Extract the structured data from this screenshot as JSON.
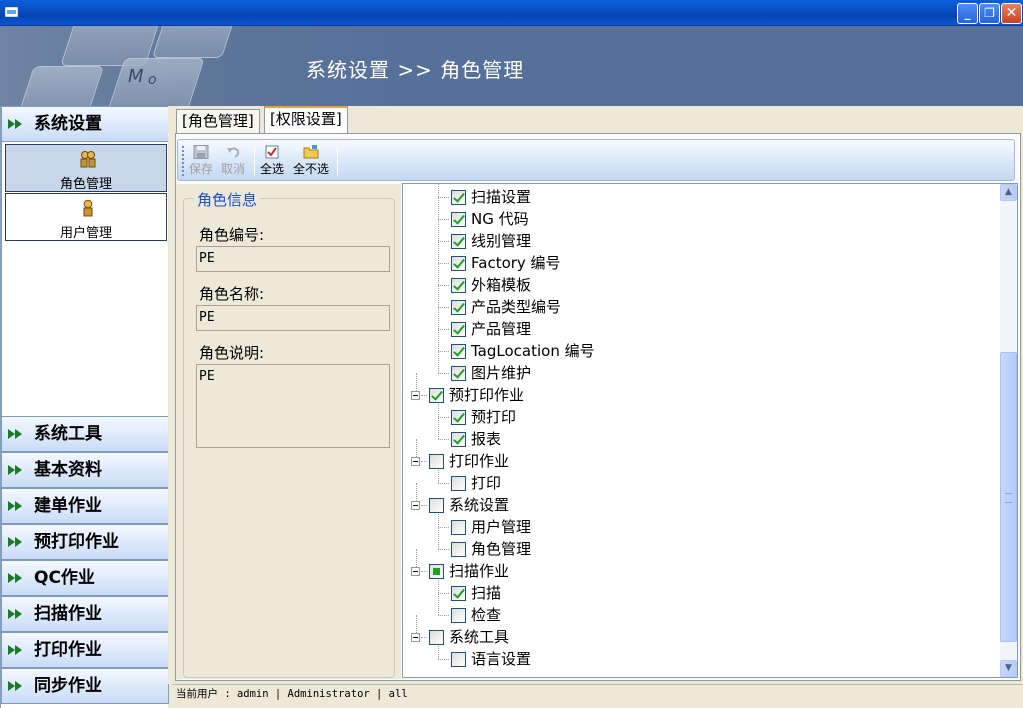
{
  "window": {
    "minimize_glyph": "_",
    "restore_glyph": "❐",
    "close_glyph": "✕"
  },
  "header": {
    "title": "系统设置 >> 角色管理",
    "keycap_letters": [
      "M",
      "o"
    ]
  },
  "sidebar": {
    "active_group": "系统设置",
    "active_subitems": [
      {
        "label": "角色管理",
        "icon": "users-icon",
        "selected": true
      },
      {
        "label": "用户管理",
        "icon": "user-icon",
        "selected": false
      }
    ],
    "groups": [
      "系统工具",
      "基本资料",
      "建单作业",
      "预打印作业",
      "QC作业",
      "扫描作业",
      "打印作业",
      "同步作业"
    ]
  },
  "tabs": [
    {
      "label": "[角色管理]",
      "active": false
    },
    {
      "label": "[权限设置]",
      "active": true
    }
  ],
  "toolbar": {
    "save": "保存",
    "cancel": "取消",
    "select_all": "全选",
    "select_none": "全不选"
  },
  "role_info": {
    "legend": "角色信息",
    "code_label": "角色编号:",
    "code_value": "PE",
    "name_label": "角色名称:",
    "name_value": "PE",
    "desc_label": "角色说明:",
    "desc_value": "PE"
  },
  "tree": {
    "nodes": [
      {
        "label": "扫描设置",
        "level": 1,
        "state": "checked"
      },
      {
        "label": "NG 代码",
        "level": 1,
        "state": "checked"
      },
      {
        "label": "线别管理",
        "level": 1,
        "state": "checked"
      },
      {
        "label": "Factory 编号",
        "level": 1,
        "state": "checked"
      },
      {
        "label": "外箱模板",
        "level": 1,
        "state": "checked"
      },
      {
        "label": "产品类型编号",
        "level": 1,
        "state": "checked"
      },
      {
        "label": "产品管理",
        "level": 1,
        "state": "checked"
      },
      {
        "label": "TagLocation 编号",
        "level": 1,
        "state": "checked"
      },
      {
        "label": "图片维护",
        "level": 1,
        "state": "checked"
      },
      {
        "label": "预打印作业",
        "level": 0,
        "state": "checked"
      },
      {
        "label": "预打印",
        "level": 1,
        "state": "checked"
      },
      {
        "label": "报表",
        "level": 1,
        "state": "checked"
      },
      {
        "label": "打印作业",
        "level": 0,
        "state": "unchecked"
      },
      {
        "label": "打印",
        "level": 1,
        "state": "unchecked"
      },
      {
        "label": "系统设置",
        "level": 0,
        "state": "unchecked"
      },
      {
        "label": "用户管理",
        "level": 1,
        "state": "unchecked"
      },
      {
        "label": "角色管理",
        "level": 1,
        "state": "unchecked"
      },
      {
        "label": "扫描作业",
        "level": 0,
        "state": "partial"
      },
      {
        "label": "扫描",
        "level": 1,
        "state": "checked"
      },
      {
        "label": "检查",
        "level": 1,
        "state": "unchecked"
      },
      {
        "label": "系统工具",
        "level": 0,
        "state": "unchecked"
      },
      {
        "label": "语言设置",
        "level": 1,
        "state": "unchecked"
      }
    ]
  },
  "scrollbar": {
    "up": "▲",
    "down": "▼"
  },
  "status": {
    "text": "当前用户 : admin | Administrator | all"
  },
  "colors": {
    "accent": "#1c4ecf",
    "check": "#21a121",
    "banner": "#56709a"
  }
}
